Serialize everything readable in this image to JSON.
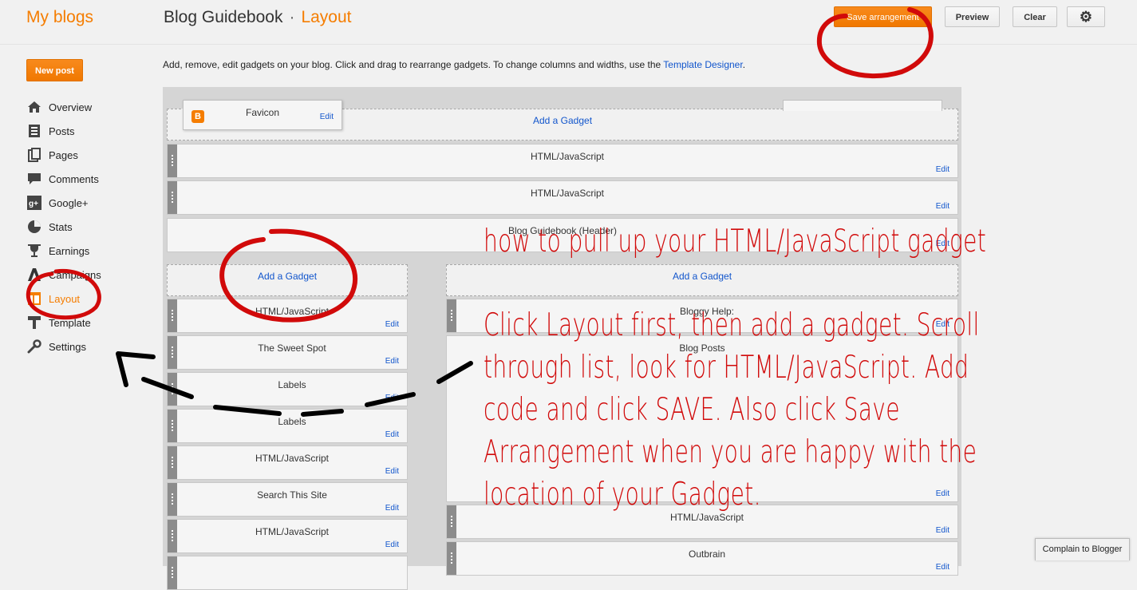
{
  "header": {
    "brand": "My blogs",
    "blog_name": "Blog Guidebook",
    "separator": "·",
    "current_page": "Layout",
    "save_arrangement": "Save arrangement",
    "preview": "Preview",
    "clear": "Clear",
    "settings_icon": "gear-icon"
  },
  "sidebar": {
    "new_post": "New post",
    "items": [
      {
        "label": "Overview",
        "icon": "home-icon"
      },
      {
        "label": "Posts",
        "icon": "posts-icon"
      },
      {
        "label": "Pages",
        "icon": "pages-icon"
      },
      {
        "label": "Comments",
        "icon": "comments-icon"
      },
      {
        "label": "Google+",
        "icon": "google-plus-icon"
      },
      {
        "label": "Stats",
        "icon": "stats-icon"
      },
      {
        "label": "Earnings",
        "icon": "trophy-icon"
      },
      {
        "label": "Campaigns",
        "icon": "campaigns-icon"
      },
      {
        "label": "Layout",
        "icon": "layout-icon"
      },
      {
        "label": "Template",
        "icon": "template-icon"
      },
      {
        "label": "Settings",
        "icon": "wrench-icon"
      }
    ]
  },
  "main": {
    "description": "Add, remove, edit gadgets on your blog. Click and drag to rearrange gadgets. To change columns and widths, use the",
    "template_designer_link": "Template Designer",
    "description_end": "."
  },
  "layout": {
    "dragging_gadget": {
      "title": "Favicon",
      "edit": "Edit"
    },
    "add_gadget": "Add a Gadget",
    "edit": "Edit",
    "top_gadgets": [
      "HTML/JavaScript",
      "HTML/JavaScript"
    ],
    "header_gadget": "Blog Guidebook (Header)",
    "left_column": [
      "HTML/JavaScript",
      "The Sweet Spot",
      "Labels",
      "Labels",
      "HTML/JavaScript",
      "Search This Site",
      "HTML/JavaScript"
    ],
    "right_column": [
      "Bloggy Help:",
      "Blog Posts",
      "HTML/JavaScript",
      "Outbrain"
    ]
  },
  "annotation": {
    "title": "how to pull up your HTML/JavaScript gadget",
    "lines": [
      "Click Layout first, then add a gadget. Scroll",
      "through list, look for HTML/JavaScript. Add",
      "code and click SAVE. Also click Save",
      "Arrangement when you are happy with the",
      "location of your Gadget."
    ],
    "color": "#d10a0a"
  },
  "footer": {
    "complain": "Complain to Blogger"
  },
  "colors": {
    "accent": "#f57d00",
    "link": "#1155cc"
  }
}
